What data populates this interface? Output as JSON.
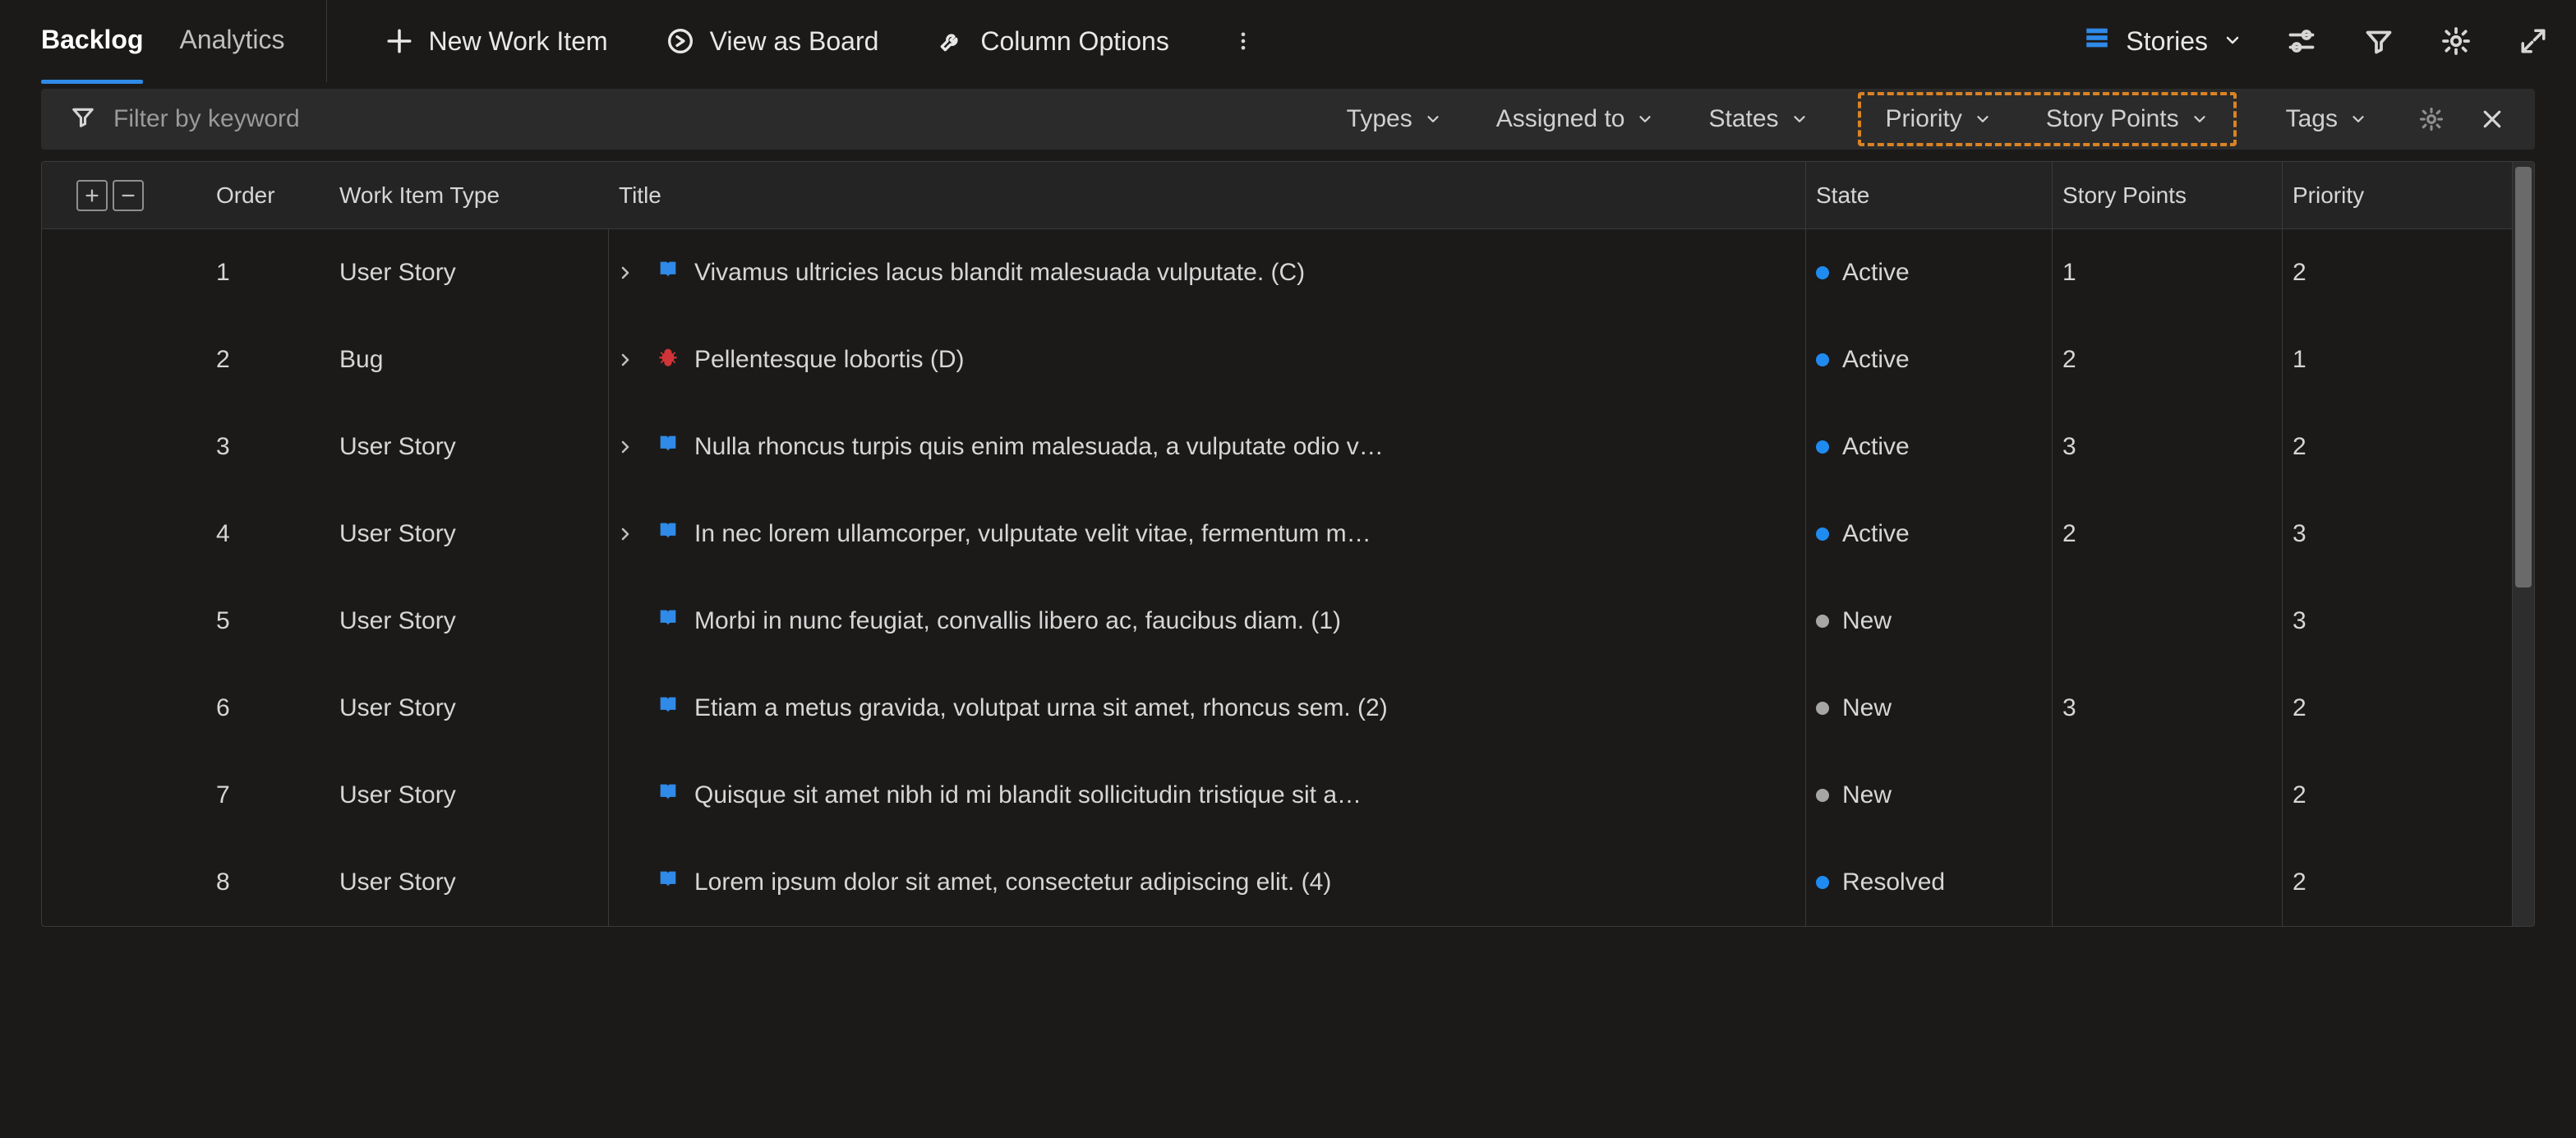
{
  "tabs": {
    "backlog": "Backlog",
    "analytics": "Analytics"
  },
  "toolbar": {
    "new_item": "New Work Item",
    "view_board": "View as Board",
    "column_options": "Column Options"
  },
  "level_selector": {
    "label": "Stories"
  },
  "filter": {
    "placeholder": "Filter by keyword",
    "fields": {
      "types": "Types",
      "assigned": "Assigned to",
      "states": "States",
      "priority": "Priority",
      "story_points": "Story Points",
      "tags": "Tags"
    }
  },
  "columns": {
    "order": "Order",
    "type": "Work Item Type",
    "title": "Title",
    "state": "State",
    "points": "Story Points",
    "priority": "Priority"
  },
  "state_labels": {
    "Active": "Active",
    "New": "New",
    "Resolved": "Resolved"
  },
  "rows": [
    {
      "order": "1",
      "type": "User Story",
      "kind": "story",
      "expandable": true,
      "title": "Vivamus ultricies lacus blandit malesuada vulputate. (C)",
      "state": "Active",
      "points": "1",
      "priority": "2"
    },
    {
      "order": "2",
      "type": "Bug",
      "kind": "bug",
      "expandable": true,
      "title": "Pellentesque lobortis (D)",
      "state": "Active",
      "points": "2",
      "priority": "1"
    },
    {
      "order": "3",
      "type": "User Story",
      "kind": "story",
      "expandable": true,
      "title": "Nulla rhoncus turpis quis enim malesuada, a vulputate odio v…",
      "state": "Active",
      "points": "3",
      "priority": "2"
    },
    {
      "order": "4",
      "type": "User Story",
      "kind": "story",
      "expandable": true,
      "title": "In nec lorem ullamcorper, vulputate velit vitae, fermentum m…",
      "state": "Active",
      "points": "2",
      "priority": "3"
    },
    {
      "order": "5",
      "type": "User Story",
      "kind": "story",
      "expandable": false,
      "title": "Morbi in nunc feugiat, convallis libero ac, faucibus diam. (1)",
      "state": "New",
      "points": "",
      "priority": "3"
    },
    {
      "order": "6",
      "type": "User Story",
      "kind": "story",
      "expandable": false,
      "title": "Etiam a metus gravida, volutpat urna sit amet, rhoncus sem. (2)",
      "state": "New",
      "points": "3",
      "priority": "2"
    },
    {
      "order": "7",
      "type": "User Story",
      "kind": "story",
      "expandable": false,
      "title": "Quisque sit amet nibh id mi blandit sollicitudin tristique sit a…",
      "state": "New",
      "points": "",
      "priority": "2"
    },
    {
      "order": "8",
      "type": "User Story",
      "kind": "story",
      "expandable": false,
      "title": "Lorem ipsum dolor sit amet, consectetur adipiscing elit. (4)",
      "state": "Resolved",
      "points": "",
      "priority": "2"
    }
  ]
}
